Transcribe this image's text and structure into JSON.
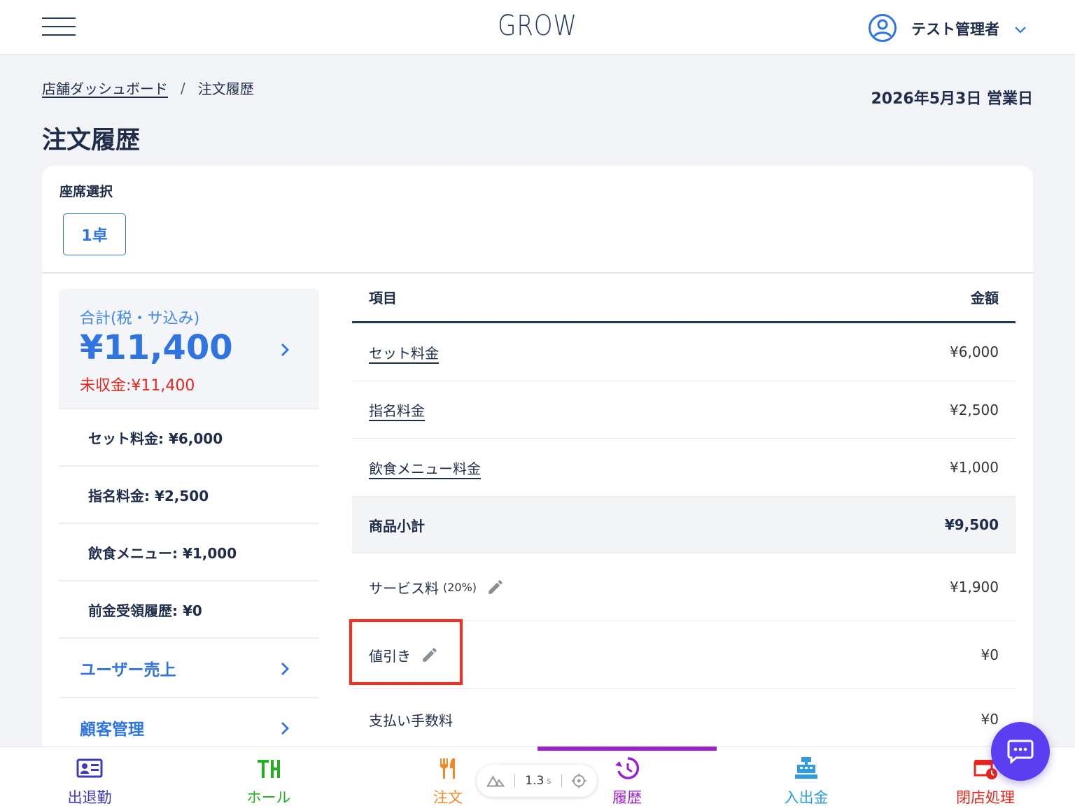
{
  "header": {
    "logo": "GROW",
    "user_name": "テスト管理者"
  },
  "breadcrumb": {
    "parent": "店舗ダッシュボード",
    "separator": "/",
    "current": "注文履歴"
  },
  "business_date": "2026年5月3日 営業日",
  "page_title": "注文履歴",
  "seat": {
    "label": "座席選択",
    "selected": "1卓"
  },
  "summary": {
    "total_label": "合計(税・サ込み)",
    "total_value": "¥11,400",
    "unpaid": "未収金:¥11,400",
    "breakdown": [
      "セット料金: ¥6,000",
      "指名料金: ¥2,500",
      "飲食メニュー: ¥1,000",
      "前金受領履歴: ¥0"
    ],
    "links": [
      "ユーザー売上",
      "顧客管理"
    ]
  },
  "table": {
    "col_item": "項目",
    "col_amount": "金額",
    "rows": [
      {
        "item": "セット料金",
        "amount": "¥6,000"
      },
      {
        "item": "指名料金",
        "amount": "¥2,500"
      },
      {
        "item": "飲食メニュー料金",
        "amount": "¥1,000"
      },
      {
        "item": "商品小計",
        "amount": "¥9,500"
      },
      {
        "item": "サービス料",
        "pct": "(20%)",
        "amount": "¥1,900"
      },
      {
        "item": "値引き",
        "amount": "¥0"
      },
      {
        "item": "支払い手数料",
        "amount": "¥0"
      }
    ]
  },
  "bottom_nav": [
    {
      "label": "出退勤",
      "color": "#3b3ab8",
      "icon": "id-card-icon"
    },
    {
      "label": "ホール",
      "color": "#22b020",
      "icon": "hall-icon"
    },
    {
      "label": "注文",
      "color": "#f08a24",
      "icon": "fork-knife-icon"
    },
    {
      "label": "履歴",
      "color": "#9c1fd1",
      "icon": "history-icon"
    },
    {
      "label": "入出金",
      "color": "#2f9be0",
      "icon": "cash-register-icon"
    },
    {
      "label": "閉店処理",
      "color": "#e8251a",
      "icon": "close-store-icon"
    }
  ],
  "perf": {
    "value": "1.3",
    "unit": "s"
  },
  "colors": {
    "primary": "#2f74e0",
    "navy": "#1f3a5f",
    "alert": "#e8251a",
    "history_active": "#9c1fd1",
    "chat": "#5b3df2"
  }
}
